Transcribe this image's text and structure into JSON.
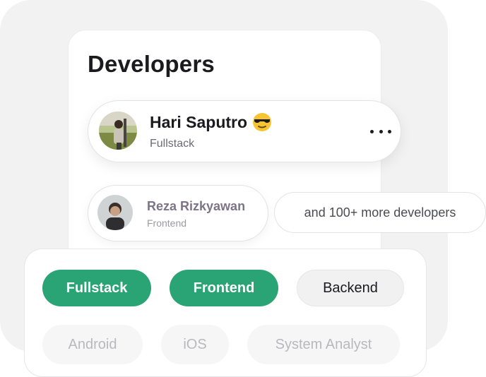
{
  "title": "Developers",
  "primary_profile": {
    "name": "Hari Saputro",
    "role": "Fullstack",
    "emoji": "sunglasses-emoji",
    "menu_icon": "more-horizontal-icon"
  },
  "secondary_profile": {
    "name": "Reza Rizkyawan",
    "role": "Frontend"
  },
  "more_developers": "and 100+ more developers",
  "filters": [
    {
      "label": "Fullstack",
      "state": "active"
    },
    {
      "label": "Frontend",
      "state": "active"
    },
    {
      "label": "Backend",
      "state": "inactive"
    },
    {
      "label": "Android",
      "state": "faded"
    },
    {
      "label": "iOS",
      "state": "faded"
    },
    {
      "label": "System Analyst",
      "state": "faded"
    }
  ],
  "colors": {
    "accent": "#2aa474",
    "background": "#f2f2f3",
    "text": "#1b1b1f"
  }
}
